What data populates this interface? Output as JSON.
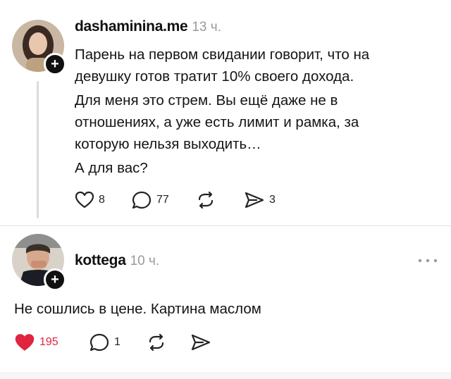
{
  "post1": {
    "username": "dashaminina.me",
    "time": "13 ч.",
    "paragraphs": [
      "Парень на первом свидании говорит, что на девушку готов тратит 10% своего дохода.",
      "Для меня это стрем. Вы ещё даже не в отношениях, а уже есть лимит и рамка, за которую нельзя выходить…",
      "А для вас?"
    ],
    "likes": "8",
    "comments": "77",
    "reposts": "",
    "shares": "3"
  },
  "post2": {
    "username": "kottega",
    "time": "10 ч.",
    "text": "Не сошлись в цене. Картина маслом",
    "likes": "195",
    "comments": "1",
    "menu_icon": "more-horizontal-icon",
    "like_color": "#e0253f"
  }
}
